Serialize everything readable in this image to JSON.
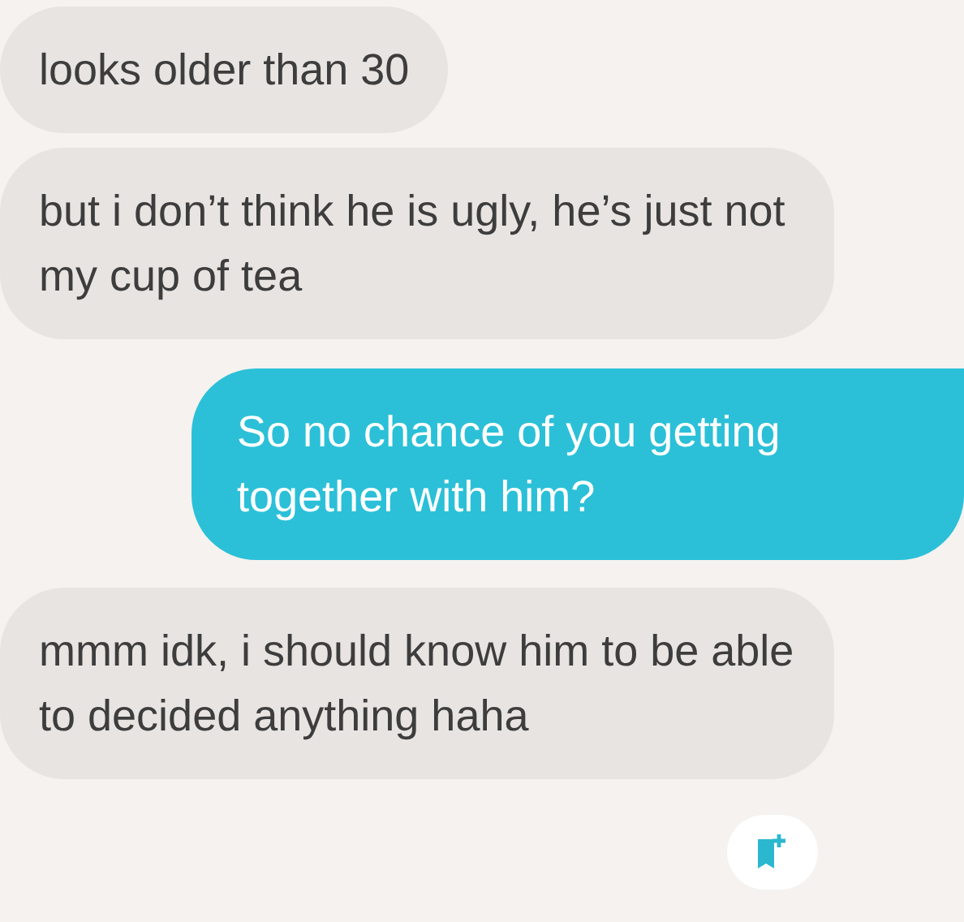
{
  "messages": [
    {
      "kind": "incoming",
      "text": "looks older than 30"
    },
    {
      "kind": "incoming",
      "text": "but i don’t think he is ugly, he’s just not my cup of tea"
    },
    {
      "kind": "outgoing",
      "text": "So no chance of you getting together with him?"
    },
    {
      "kind": "incoming",
      "text": "mmm idk, i should know him to be able to decided anything haha"
    }
  ]
}
